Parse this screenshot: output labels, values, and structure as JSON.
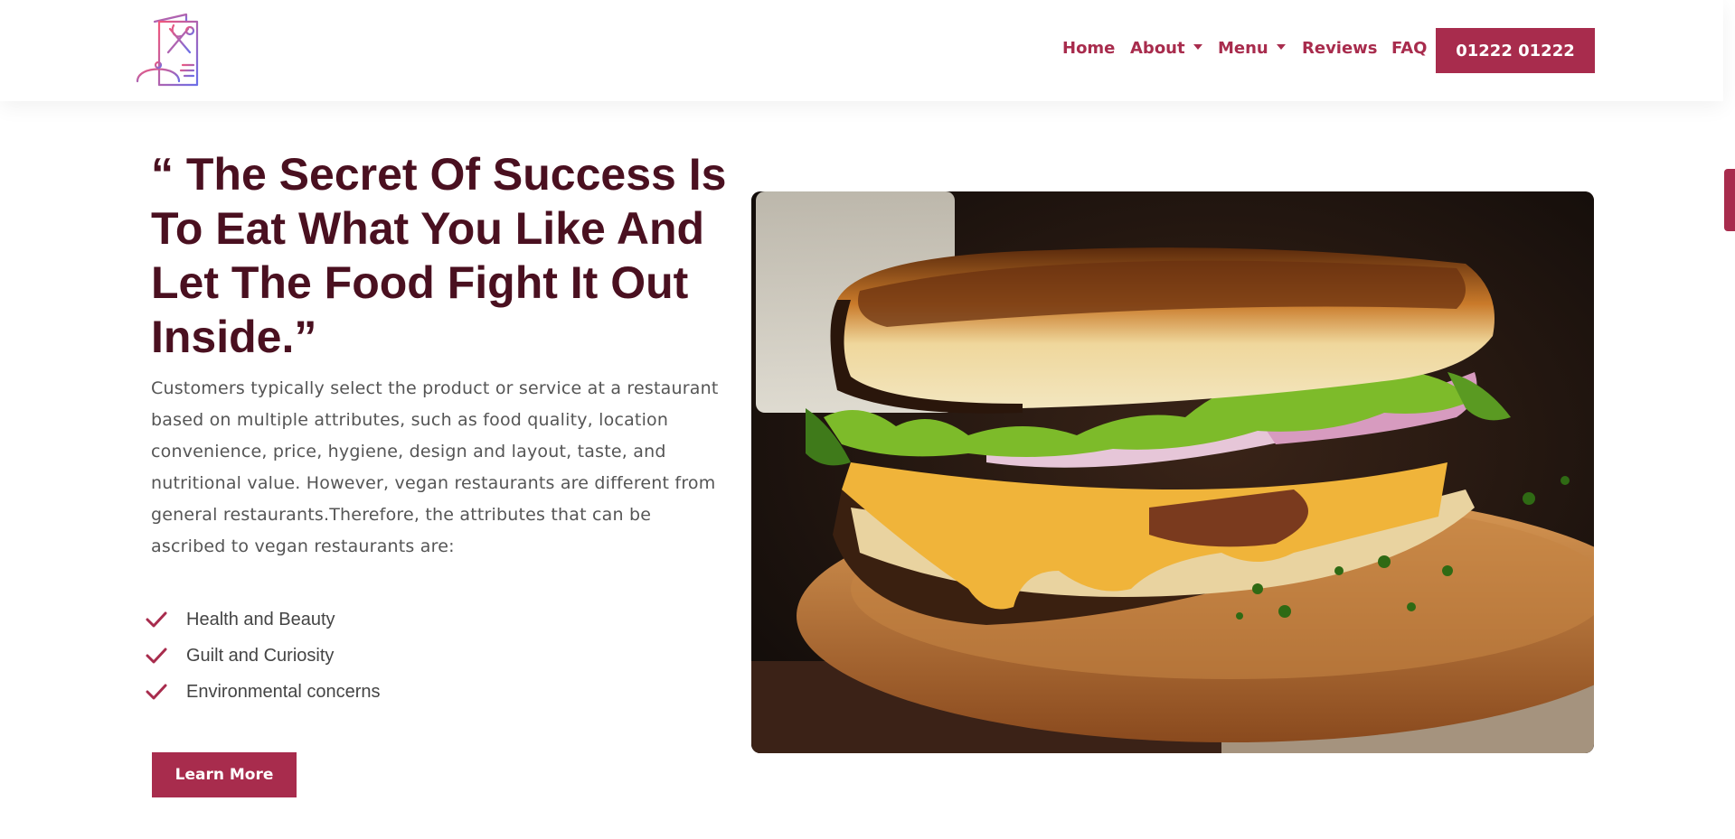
{
  "header": {
    "logo_icon": "restaurant-menu-cloche-icon",
    "nav": {
      "home": "Home",
      "about": "About",
      "menu": "Menu",
      "reviews": "Reviews",
      "faq": "FAQ"
    },
    "phone": "01222 01222"
  },
  "hero": {
    "quote": "“ The Secret Of Success Is To Eat What You Like And Let The Food Fight It Out Inside.”",
    "description": "Customers typically select the product or service at a restaurant based on multiple attributes, such as food quality, location convenience, price, hygiene, design and layout, taste, and nutritional value. However, vegan restaurants are different from general restaurants.Therefore, the attributes that can be ascribed to vegan restaurants are:",
    "features": [
      {
        "label": "Health and Beauty",
        "icon": "check-icon"
      },
      {
        "label": "Guilt and Curiosity",
        "icon": "check-icon"
      },
      {
        "label": "Environmental concerns",
        "icon": "check-icon"
      }
    ],
    "cta": "Learn More",
    "image": "grilled-sandwich-photo"
  },
  "colors": {
    "accent": "#a82c4d",
    "heading": "#4a1020",
    "body_text": "#555555"
  }
}
